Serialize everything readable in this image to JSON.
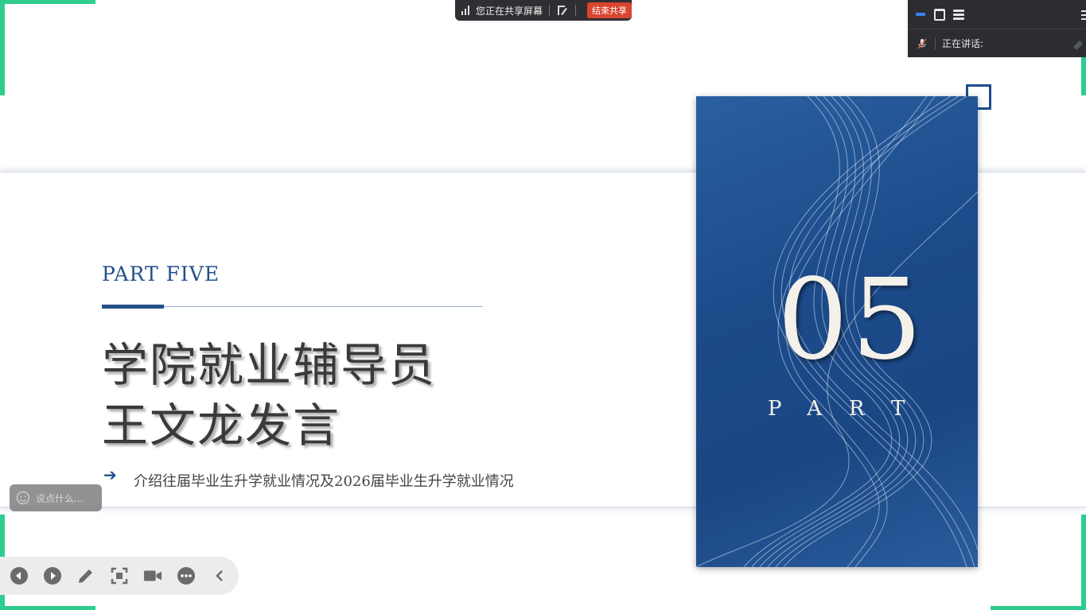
{
  "share_bar": {
    "status": "您正在共享屏幕",
    "stop_label": "结束共享"
  },
  "meeting_panel": {
    "speaking_label": "正在讲话:"
  },
  "slide": {
    "part_label": "PART FIVE",
    "title_line1": "学院就业辅导员",
    "title_line2": "王文龙发言",
    "subtitle": "介绍往届毕业生升学就业情况及2026届毕业生升学就业情况",
    "card_number": "05",
    "card_word": "PART"
  },
  "chat": {
    "placeholder": "说点什么..."
  },
  "colors": {
    "accent": "#23508a",
    "frame_green": "#2ecc8e",
    "stop_red": "#d9452f"
  }
}
